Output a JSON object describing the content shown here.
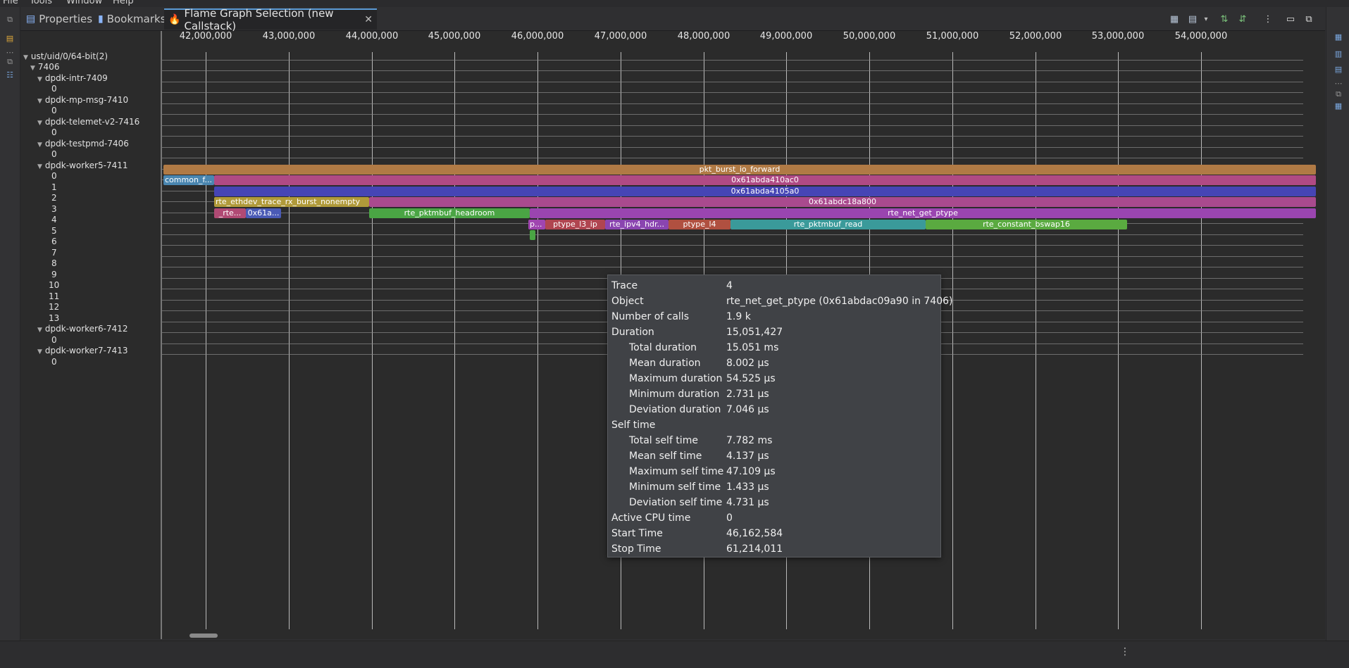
{
  "menubar": {
    "items": [
      "File",
      "Tools",
      "Window",
      "Help"
    ]
  },
  "tabs": [
    {
      "label": "Properties",
      "icon": "properties-icon"
    },
    {
      "label": "Bookmarks",
      "icon": "bookmarks-icon"
    },
    {
      "label": "Flame Graph Selection (new Callstack)",
      "icon": "flame-icon",
      "active": true
    }
  ],
  "ruler": {
    "ticks": [
      "42,000,000",
      "43,000,000",
      "44,000,000",
      "45,000,000",
      "46,000,000",
      "47,000,000",
      "48,000,000",
      "49,000,000",
      "50,000,000",
      "51,000,000",
      "52,000,000",
      "53,000,000",
      "54,000,000"
    ]
  },
  "tree": [
    {
      "label": "ust/uid/0/64-bit(2)",
      "expanded": true
    },
    {
      "label": "7406",
      "expanded": true
    },
    {
      "label": "dpdk-intr-7409",
      "expanded": true
    },
    {
      "label": "0"
    },
    {
      "label": "dpdk-mp-msg-7410",
      "expanded": true
    },
    {
      "label": "0"
    },
    {
      "label": "dpdk-telemet-v2-7416",
      "expanded": true
    },
    {
      "label": "0"
    },
    {
      "label": "dpdk-testpmd-7406",
      "expanded": true
    },
    {
      "label": "0"
    },
    {
      "label": "dpdk-worker5-7411",
      "expanded": true
    },
    {
      "label": "0"
    },
    {
      "label": "1"
    },
    {
      "label": "2"
    },
    {
      "label": "3"
    },
    {
      "label": "4"
    },
    {
      "label": "5"
    },
    {
      "label": "6"
    },
    {
      "label": "7"
    },
    {
      "label": "8"
    },
    {
      "label": "9"
    },
    {
      "label": "10"
    },
    {
      "label": "11"
    },
    {
      "label": "12"
    },
    {
      "label": "13"
    },
    {
      "label": "dpdk-worker6-7412",
      "expanded": true
    },
    {
      "label": "0"
    },
    {
      "label": "dpdk-worker7-7413",
      "expanded": true
    },
    {
      "label": "0"
    }
  ],
  "flame": {
    "bars": [
      {
        "label": "pkt_burst_io_forward",
        "color": "#b07a45"
      },
      {
        "label": "common_f...",
        "color": "#4a86b0"
      },
      {
        "label": "0x61abda410ac0",
        "color": "#b04a84"
      },
      {
        "label": "0x61abda4105a0",
        "color": "#4645b5"
      },
      {
        "label": "rte_ethdev_trace_rx_burst_nonempty",
        "color": "#b09a3a"
      },
      {
        "label": "0x61abdc18a800",
        "color": "#a94a8e"
      },
      {
        "label": "_rte...",
        "color": "#b04a74"
      },
      {
        "label": "0x61a...",
        "color": "#4a5ab5"
      },
      {
        "label": "rte_pktmbuf_headroom",
        "color": "#4aa544"
      },
      {
        "label": "rte_net_get_ptype",
        "color": "#9a45b0"
      },
      {
        "label": "p...",
        "color": "#a045b0"
      },
      {
        "label": "ptype_l3_ip",
        "color": "#b04550"
      },
      {
        "label": "rte_ipv4_hdr...",
        "color": "#8a45b0"
      },
      {
        "label": "ptype_l4",
        "color": "#b05040"
      },
      {
        "label": "rte_pktmbuf_read",
        "color": "#3a9a9a"
      },
      {
        "label": "rte_constant_bswap16",
        "color": "#5aaa40"
      },
      {
        "label": "",
        "color": "#4aa544"
      }
    ]
  },
  "tooltip": {
    "rows": [
      {
        "key": "Trace",
        "value": "4"
      },
      {
        "key": "Object",
        "value": "rte_net_get_ptype (0x61abdac09a90 in 7406)"
      },
      {
        "key": "Number of calls",
        "value": "1.9 k"
      },
      {
        "key": "Duration",
        "value": "15,051,427"
      },
      {
        "key": "Total duration",
        "value": "15.051 ms",
        "indent": true
      },
      {
        "key": "Mean duration",
        "value": "8.002 µs",
        "indent": true
      },
      {
        "key": "Maximum duration",
        "value": "54.525 µs",
        "indent": true
      },
      {
        "key": "Minimum duration",
        "value": "2.731 µs",
        "indent": true
      },
      {
        "key": "Deviation duration",
        "value": "7.046 µs",
        "indent": true
      },
      {
        "key": "Self time",
        "value": ""
      },
      {
        "key": "Total self time",
        "value": "7.782 ms",
        "indent": true
      },
      {
        "key": "Mean self time",
        "value": "4.137 µs",
        "indent": true
      },
      {
        "key": "Maximum self time",
        "value": "47.109 µs",
        "indent": true
      },
      {
        "key": "Minimum self time",
        "value": "1.433 µs",
        "indent": true
      },
      {
        "key": "Deviation self time",
        "value": "4.731 µs",
        "indent": true
      },
      {
        "key": "Active CPU time",
        "value": "0"
      },
      {
        "key": "Start Time",
        "value": "46,162,584"
      },
      {
        "key": "Stop Time",
        "value": "61,214,011"
      }
    ]
  }
}
